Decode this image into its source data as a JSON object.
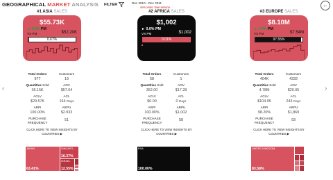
{
  "header": {
    "title_part1": "GEOGRAPHICAL ",
    "title_part2": "MARKET",
    "title_part3": " ANALYSIS",
    "filter_label": "FILTER",
    "date_range": "Dec 2010 - Dec 2011",
    "time_period_label": "SPECIFIED TIME PERIOD"
  },
  "nav": {
    "prev": "‹",
    "next": "›",
    "back": "←"
  },
  "cards": [
    {
      "rank_title": "#1 ASIA",
      "rank_sub": " SALES",
      "theme": "red",
      "kpi_value": "$55.73K",
      "kpi_change": "6.8%",
      "kpi_period": "PM",
      "kpi_vs": "VS PM",
      "kpi_prev": "$52.20K",
      "progress_label": "0.67%",
      "progress": 0.0067,
      "spark": [
        10,
        12,
        8,
        14,
        9,
        11,
        16,
        10,
        14,
        8,
        13,
        18,
        11,
        15,
        9,
        12,
        14
      ],
      "stats": {
        "total_orders_label": "Total Orders",
        "total_orders": "977",
        "customers_label": "Customers",
        "customers": "19",
        "quantities_label": "Quantities",
        "quantities_sold": "Sold",
        "quantities": "36.15K",
        "aov_label": "AOV",
        "aov": "$57.04",
        "aclv_label": "ACLV",
        "aclv": "$29.57K",
        "acl_label": "ACL",
        "acl": "164",
        "acl_unit": "Days",
        "arpi_label": "ARPI",
        "arpi": "100.00%",
        "arpu_label": "ARPU",
        "arpu": "$2.933",
        "freq_label": "PURCHASE FREQUENCY",
        "freq": "51"
      },
      "insight": "CLICK HERE TO VIEW INSIGHTS BY COUNTRIES ▶",
      "treemap": [
        {
          "name": "JAPAN",
          "pct": "63.41%",
          "color": "#d6535f"
        },
        {
          "name": "SINGAPO...",
          "pct": "16.37%",
          "color": "#c9414e"
        },
        {
          "name": "ISRAEL",
          "pct": "12.55%",
          "color": "#b8353f"
        },
        {
          "name": "",
          "pct": "",
          "color": "#a82d38"
        },
        {
          "name": "",
          "pct": "",
          "color": "#d96a73"
        },
        {
          "name": "",
          "pct": "",
          "color": "#e07d85"
        }
      ]
    },
    {
      "rank_title": "#2 AFRICA",
      "rank_sub": " SALES",
      "theme": "black",
      "kpi_value": "$1,002",
      "kpi_change": "0.0%",
      "kpi_period": "PM",
      "kpi_vs": "VS PM",
      "kpi_prev": "$1,002",
      "progress_label": "0.01%",
      "progress": 0.0001,
      "spark": [],
      "stats": {
        "total_orders_label": "Total Orders",
        "total_orders": "58",
        "customers_label": "Customers",
        "customers": "1",
        "quantities_label": "Quantities",
        "quantities_sold": "Sold",
        "quantities": "352.00",
        "aov_label": "AOV",
        "aov": "$17.28",
        "aclv_label": "ACLV",
        "aclv": "$0.00",
        "acl_label": "ACL",
        "acl": "0",
        "acl_unit": "Days",
        "arpi_label": "ARPI",
        "arpi": "100.00%",
        "arpu_label": "ARPU",
        "arpu": "$1,002",
        "freq_label": "PURCHASE FREQUENCY",
        "freq": "58"
      },
      "insight": "CLICK HERE TO VIEW INSIGHTS BY COUNTRIES ▶",
      "treemap": [
        {
          "name": "RSA",
          "pct": "100.00%",
          "color": "#0b0b0b"
        }
      ]
    },
    {
      "rank_title": "#3 EUROPE",
      "rank_sub": " SALES",
      "theme": "red",
      "kpi_value": "$8.10M",
      "kpi_change": "7.4%",
      "kpi_period": "PM",
      "kpi_vs": "VS PM",
      "kpi_prev": "$7.54M",
      "progress_label": "97.55%",
      "progress": 0.9755,
      "spark": [
        12,
        14,
        10,
        11,
        13,
        15,
        12,
        14,
        16,
        13,
        17,
        20,
        22,
        14
      ],
      "stats": {
        "total_orders_label": "Total Orders",
        "total_orders": "404K",
        "customers_label": "Customers",
        "customers": "4332",
        "quantities_label": "Quantities",
        "quantities_sold": "Sold",
        "quantities": "4.78M",
        "aov_label": "AOV",
        "aov": "$20.05",
        "aclv_label": "ACLV",
        "aclv": "$104.95",
        "acl_label": "ACL",
        "acl": "243",
        "acl_unit": "Days",
        "arpi_label": "ARPI",
        "arpi": "98.20%",
        "arpu_label": "ARPU",
        "arpu": "$1,869",
        "freq_label": "PURCHASE FREQUENCY",
        "freq": "93"
      },
      "insight": "CLICK HERE TO VIEW INSIGHTS BY COUNTRIES ▶",
      "treemap": [
        {
          "name": "UNITED KINGDOM",
          "pct": "83.58%",
          "color": "#d6535f"
        },
        {
          "name": "",
          "pct": "",
          "color": "#c9414e"
        },
        {
          "name": "",
          "pct": "",
          "color": "#b8353f"
        },
        {
          "name": "",
          "pct": "",
          "color": "#a82d38"
        },
        {
          "name": "",
          "pct": "",
          "color": "#d96a73"
        },
        {
          "name": "",
          "pct": "",
          "color": "#c24753"
        },
        {
          "name": "",
          "pct": "",
          "color": "#e07d85"
        },
        {
          "name": "",
          "pct": "",
          "color": "#b03440"
        }
      ]
    }
  ]
}
